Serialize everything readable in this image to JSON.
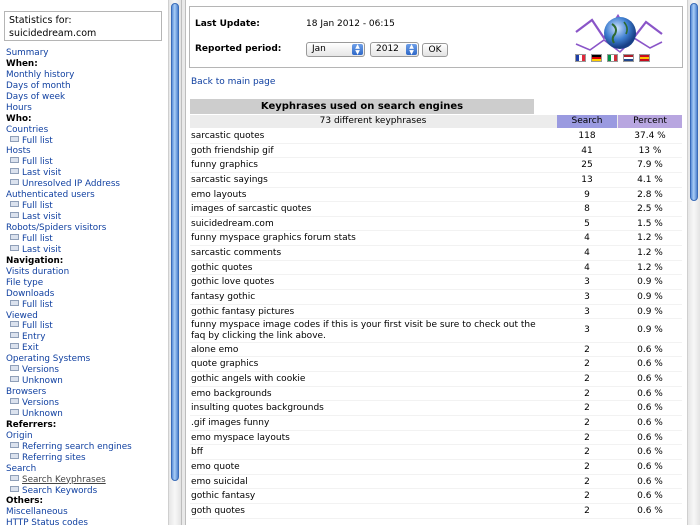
{
  "sidebar": {
    "stats_label": "Statistics for:",
    "stats_site": "suicidedream.com",
    "items": [
      {
        "label": "Summary",
        "type": "link"
      },
      {
        "label": "When:",
        "type": "head"
      },
      {
        "label": "Monthly history",
        "type": "link"
      },
      {
        "label": "Days of month",
        "type": "link"
      },
      {
        "label": "Days of week",
        "type": "link"
      },
      {
        "label": "Hours",
        "type": "link"
      },
      {
        "label": "Who:",
        "type": "head"
      },
      {
        "label": "Countries",
        "type": "link"
      },
      {
        "label": "Full list",
        "type": "sub"
      },
      {
        "label": "Hosts",
        "type": "link"
      },
      {
        "label": "Full list",
        "type": "sub"
      },
      {
        "label": "Last visit",
        "type": "sub"
      },
      {
        "label": "Unresolved IP Address",
        "type": "sub"
      },
      {
        "label": "Authenticated users",
        "type": "link"
      },
      {
        "label": "Full list",
        "type": "sub"
      },
      {
        "label": "Last visit",
        "type": "sub"
      },
      {
        "label": "Robots/Spiders visitors",
        "type": "link"
      },
      {
        "label": "Full list",
        "type": "sub"
      },
      {
        "label": "Last visit",
        "type": "sub"
      },
      {
        "label": "Navigation:",
        "type": "head"
      },
      {
        "label": "Visits duration",
        "type": "link"
      },
      {
        "label": "File type",
        "type": "link"
      },
      {
        "label": "Downloads",
        "type": "link"
      },
      {
        "label": "Full list",
        "type": "sub"
      },
      {
        "label": "Viewed",
        "type": "link"
      },
      {
        "label": "Full list",
        "type": "sub"
      },
      {
        "label": "Entry",
        "type": "sub"
      },
      {
        "label": "Exit",
        "type": "sub"
      },
      {
        "label": "Operating Systems",
        "type": "link"
      },
      {
        "label": "Versions",
        "type": "sub"
      },
      {
        "label": "Unknown",
        "type": "sub"
      },
      {
        "label": "Browsers",
        "type": "link"
      },
      {
        "label": "Versions",
        "type": "sub"
      },
      {
        "label": "Unknown",
        "type": "sub"
      },
      {
        "label": "Referrers:",
        "type": "head"
      },
      {
        "label": "Origin",
        "type": "link"
      },
      {
        "label": "Referring search engines",
        "type": "sub"
      },
      {
        "label": "Referring sites",
        "type": "sub"
      },
      {
        "label": "Search",
        "type": "link"
      },
      {
        "label": "Search Keyphrases",
        "type": "sub",
        "selected": true
      },
      {
        "label": "Search Keywords",
        "type": "sub"
      },
      {
        "label": "Others:",
        "type": "head"
      },
      {
        "label": "Miscellaneous",
        "type": "link"
      },
      {
        "label": "HTTP Status codes",
        "type": "link"
      }
    ]
  },
  "header": {
    "last_update_label": "Last Update:",
    "last_update_value": "18 Jan 2012 - 06:15",
    "period_label": "Reported period:",
    "month_value": "Jan",
    "year_value": "2012",
    "ok_label": "OK"
  },
  "flags": [
    {
      "name": "fr",
      "colors": [
        "#1f3fa8",
        "#ffffff",
        "#e0283a"
      ],
      "dir": "v"
    },
    {
      "name": "de",
      "colors": [
        "#000000",
        "#dd0000",
        "#ffce00"
      ],
      "dir": "h"
    },
    {
      "name": "it",
      "colors": [
        "#009246",
        "#ffffff",
        "#ce2b37"
      ],
      "dir": "v"
    },
    {
      "name": "nl",
      "colors": [
        "#ae1c28",
        "#ffffff",
        "#21468b"
      ],
      "dir": "h"
    },
    {
      "name": "es",
      "colors": [
        "#c60b1e",
        "#ffc400",
        "#c60b1e"
      ],
      "dir": "h"
    }
  ],
  "back_link": "Back to main page",
  "table": {
    "title": "Keyphrases used on search engines",
    "count_label": "73 different keyphrases",
    "col_search": "Search",
    "col_percent": "Percent",
    "rows": [
      {
        "phrase": "sarcastic quotes",
        "search": "118",
        "percent": "37.4 %"
      },
      {
        "phrase": "goth friendship gif",
        "search": "41",
        "percent": "13 %"
      },
      {
        "phrase": "funny graphics",
        "search": "25",
        "percent": "7.9 %"
      },
      {
        "phrase": "sarcastic sayings",
        "search": "13",
        "percent": "4.1 %"
      },
      {
        "phrase": "emo layouts",
        "search": "9",
        "percent": "2.8 %"
      },
      {
        "phrase": "images of sarcastic quotes",
        "search": "8",
        "percent": "2.5 %"
      },
      {
        "phrase": "suicidedream.com",
        "search": "5",
        "percent": "1.5 %"
      },
      {
        "phrase": "funny myspace graphics forum stats",
        "search": "4",
        "percent": "1.2 %"
      },
      {
        "phrase": "sarcastic comments",
        "search": "4",
        "percent": "1.2 %"
      },
      {
        "phrase": "gothic quotes",
        "search": "4",
        "percent": "1.2 %"
      },
      {
        "phrase": "gothic love quotes",
        "search": "3",
        "percent": "0.9 %"
      },
      {
        "phrase": "fantasy gothic",
        "search": "3",
        "percent": "0.9 %"
      },
      {
        "phrase": "gothic fantasy pictures",
        "search": "3",
        "percent": "0.9 %"
      },
      {
        "phrase": "funny myspace image codes if this is your first visit be sure to check out the faq by clicking the link above.",
        "search": "3",
        "percent": "0.9 %",
        "tall": true
      },
      {
        "phrase": "alone emo",
        "search": "2",
        "percent": "0.6 %"
      },
      {
        "phrase": "quote graphics",
        "search": "2",
        "percent": "0.6 %"
      },
      {
        "phrase": "gothic angels with cookie",
        "search": "2",
        "percent": "0.6 %"
      },
      {
        "phrase": "emo backgrounds",
        "search": "2",
        "percent": "0.6 %"
      },
      {
        "phrase": "insulting quotes backgrounds",
        "search": "2",
        "percent": "0.6 %"
      },
      {
        "phrase": ".gif images funny",
        "search": "2",
        "percent": "0.6 %"
      },
      {
        "phrase": "emo myspace layouts",
        "search": "2",
        "percent": "0.6 %"
      },
      {
        "phrase": "bff",
        "search": "2",
        "percent": "0.6 %"
      },
      {
        "phrase": "emo quote",
        "search": "2",
        "percent": "0.6 %"
      },
      {
        "phrase": "emo suicidal",
        "search": "2",
        "percent": "0.6 %"
      },
      {
        "phrase": "gothic fantasy",
        "search": "2",
        "percent": "0.6 %"
      },
      {
        "phrase": "goth quotes",
        "search": "2",
        "percent": "0.6 %"
      }
    ]
  }
}
